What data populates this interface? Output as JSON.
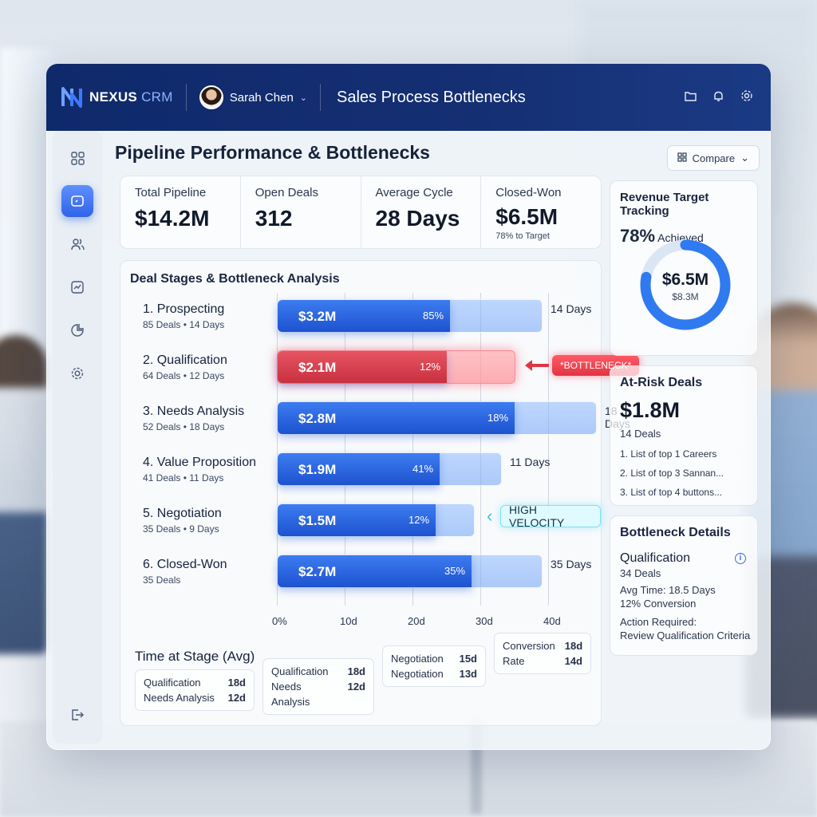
{
  "app": {
    "brand": "NEXUS",
    "brand_suffix": "CRM",
    "user_name": "Sarah Chen",
    "view_title": "Sales Process Bottlenecks"
  },
  "topbar_icons": [
    "folder-icon",
    "bell-icon",
    "gear-icon"
  ],
  "sidebar": {
    "items": [
      "grid-icon",
      "dashboard-icon",
      "users-icon",
      "chart-icon",
      "pie-icon",
      "settings-icon"
    ],
    "bottom": "logout-icon"
  },
  "page": {
    "title": "Pipeline Performance & Bottlenecks",
    "compare_label": "Compare"
  },
  "kpis": [
    {
      "label": "Total Pipeline",
      "value": "$14.2M",
      "sub": ""
    },
    {
      "label": "Open Deals",
      "value": "312",
      "sub": ""
    },
    {
      "label": "Average Cycle",
      "value": "28 Days",
      "sub": ""
    },
    {
      "label": "Closed-Won",
      "value": "$6.5M",
      "sub": "78% to Target"
    }
  ],
  "stages_card": {
    "title": "Deal Stages & Bottleneck Analysis",
    "bottleneck_tag": "*BOTTLENECK*",
    "velocity_tag": "HIGH VELOCITY",
    "axis": [
      "0%",
      "10d",
      "20d",
      "30d",
      "40d"
    ],
    "stages": [
      {
        "name": "1. Prospecting",
        "sub": "85 Deals • 14 Days",
        "amount": "$3.2M",
        "pct": "85%",
        "days": "14 Days",
        "fill": 0.65,
        "track_days": 14
      },
      {
        "name": "2. Qualification",
        "sub": "64 Deals • 12 Days",
        "amount": "$2.1M",
        "pct": "12%",
        "days": "",
        "fill": 0.71,
        "track_days": 12
      },
      {
        "name": "3. Needs Analysis",
        "sub": "52 Deals • 18 Days",
        "amount": "$2.8M",
        "pct": "18%",
        "days": "18 Days",
        "fill": 0.74,
        "track_days": 18
      },
      {
        "name": "4. Value Proposition",
        "sub": "41 Deals • 11 Days",
        "amount": "$1.9M",
        "pct": "41%",
        "days": "11 Days",
        "fill": 0.72,
        "track_days": 11
      },
      {
        "name": "5. Negotiation",
        "sub": "35 Deals • 9 Days",
        "amount": "$1.5M",
        "pct": "12%",
        "days": "",
        "fill": 0.8,
        "track_days": 9
      },
      {
        "name": "6. Closed-Won",
        "sub": "35 Deals",
        "amount": "$2.7M",
        "pct": "35%",
        "days": "35 Days",
        "fill": 0.73,
        "track_days": 14
      }
    ],
    "time_at_stage": {
      "title": "Time at Stage (Avg)",
      "boxes": [
        [
          {
            "k": "Qualification",
            "v": "18d"
          },
          {
            "k": "Needs Analysis",
            "v": "12d"
          }
        ],
        [
          {
            "k": "Qualification",
            "v": "18d"
          },
          {
            "k": "Needs Analysis",
            "v": "12d"
          }
        ],
        [
          {
            "k": "Negotiation",
            "v": "15d"
          },
          {
            "k": "Negotiation",
            "v": "13d"
          }
        ],
        [
          {
            "k": "Conversion",
            "v": "18d"
          },
          {
            "k": "Rate",
            "v": "14d"
          }
        ]
      ]
    }
  },
  "revenue": {
    "title": "Revenue Target Tracking",
    "pct": "78%",
    "achieved_label": "Achieved",
    "value": "$6.5M",
    "target": "$8.3M",
    "progress": 0.78
  },
  "at_risk": {
    "title": "At-Risk Deals",
    "value": "$1.8M",
    "count": "14 Deals",
    "items": [
      "1. List of top 1 Careers",
      "2. List of top 3 Sannan...",
      "3. List of top 4 buttons..."
    ]
  },
  "bottleneck": {
    "title": "Bottleneck Details",
    "stage": "Qualification",
    "deals": "34 Deals",
    "avg_time": "Avg Time: 18.5 Days",
    "conversion": "12% Conversion",
    "action_label": "Action Required:",
    "action": "Review Qualification Criteria"
  }
}
